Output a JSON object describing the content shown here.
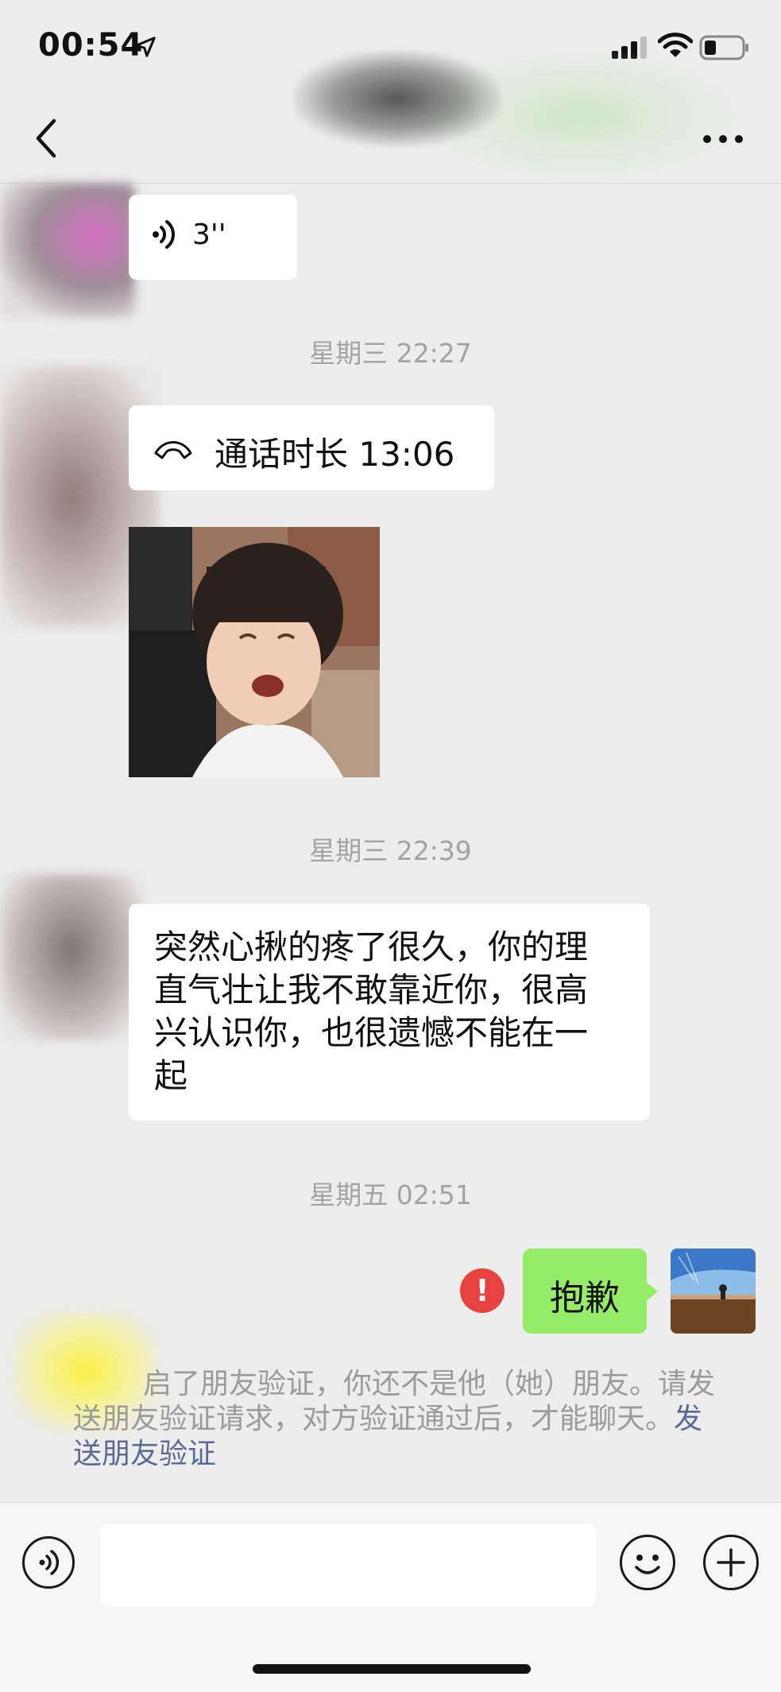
{
  "status_bar": {
    "time": "00:54"
  },
  "chat": {
    "voice_message": {
      "duration": "3''"
    },
    "timestamp_1": "星期三 22:27",
    "call": {
      "label": "通话时长 13:06"
    },
    "timestamp_2": "星期三 22:39",
    "incoming_text": "突然心揪的疼了很久，你的理直气壮让我不敢靠近你，很高兴认识你，也很遗憾不能在一起",
    "timestamp_3": "星期五 02:51",
    "outgoing_text": "抱歉",
    "error_mark": "!",
    "system_notice": "启了朋友验证，你还不是他（她）朋友。请发送朋友验证请求，对方验证通过后，才能聊天。",
    "system_notice_link": "发送朋友验证"
  },
  "colors": {
    "background": "#ededed",
    "incoming_bubble": "#ffffff",
    "outgoing_bubble": "#95ec69",
    "error": "#e64340",
    "link": "#576b95"
  }
}
